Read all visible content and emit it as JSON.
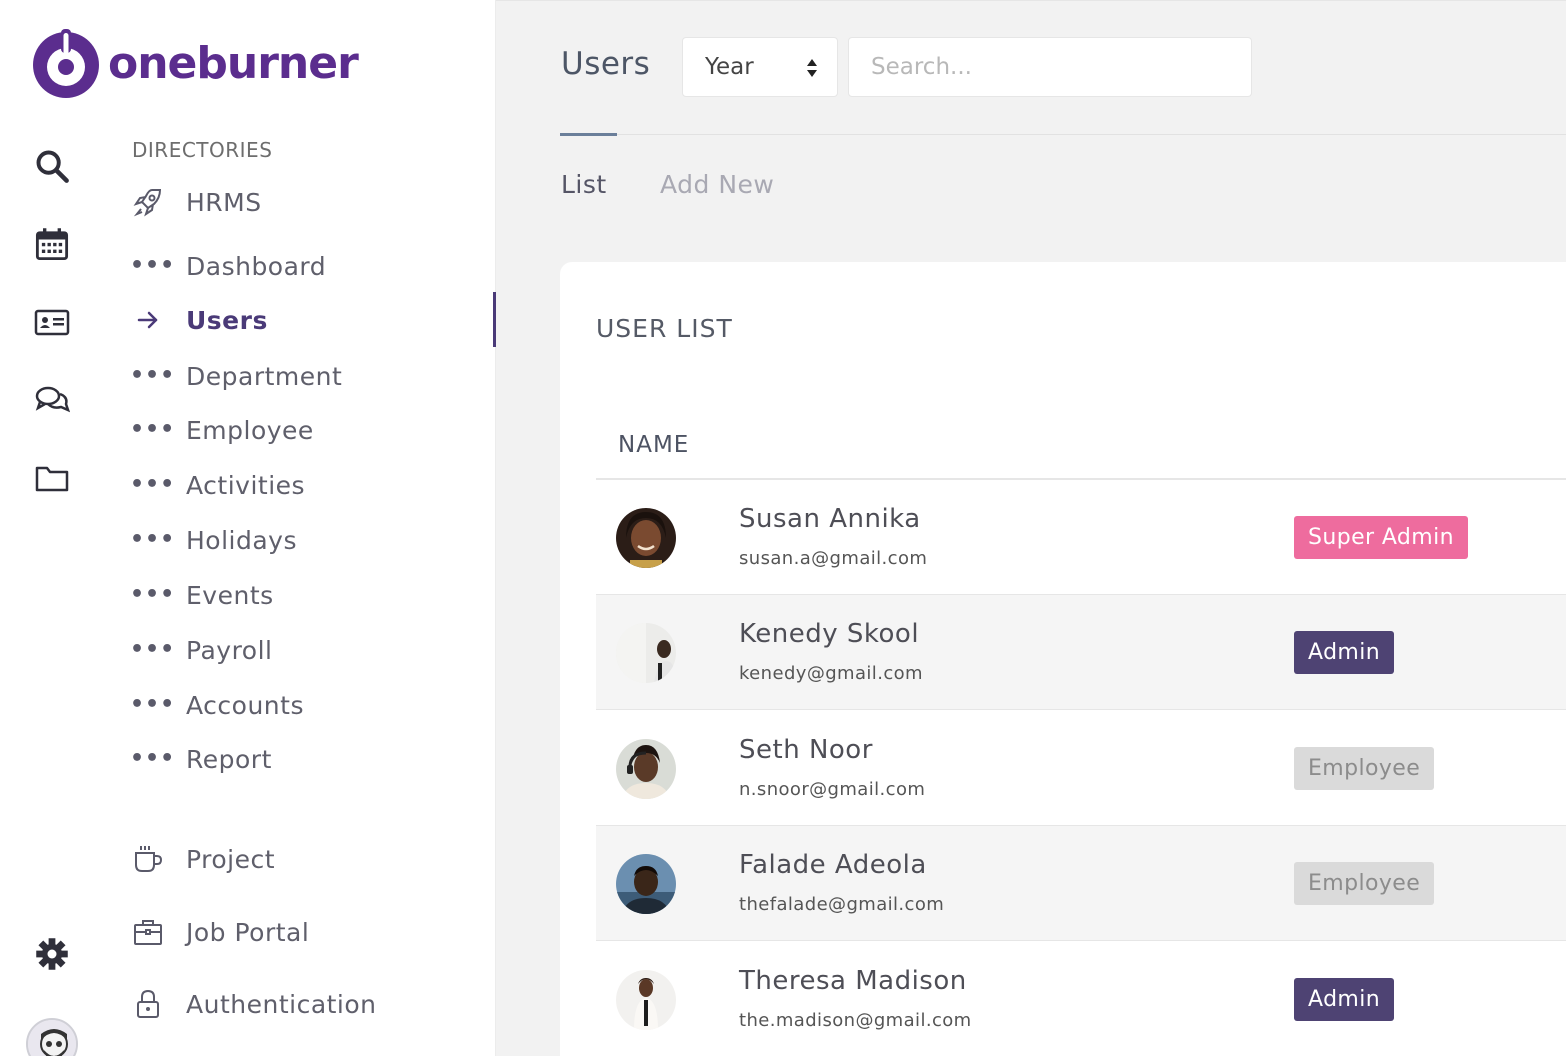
{
  "brand": {
    "name": "oneburner",
    "color": "#5b2d8e"
  },
  "rail": {
    "icons": [
      "search-icon",
      "calendar-icon",
      "id-card-icon",
      "chat-icon",
      "folder-icon",
      "settings-icon"
    ]
  },
  "sidebar": {
    "section_label": "DIRECTORIES",
    "hrms_label": "HRMS",
    "items": [
      {
        "label": "Dashboard"
      },
      {
        "label": "Users",
        "active": true
      },
      {
        "label": "Department"
      },
      {
        "label": "Employee"
      },
      {
        "label": "Activities"
      },
      {
        "label": "Holidays"
      },
      {
        "label": "Events"
      },
      {
        "label": "Payroll"
      },
      {
        "label": "Accounts"
      },
      {
        "label": "Report"
      }
    ],
    "project_label": "Project",
    "job_portal_label": "Job Portal",
    "authentication_label": "Authentication",
    "dots": "•••"
  },
  "header": {
    "title": "Users",
    "period_select": {
      "value": "Year"
    },
    "search": {
      "placeholder": "Search..."
    }
  },
  "tabs": [
    {
      "label": "List",
      "active": true
    },
    {
      "label": "Add New"
    }
  ],
  "user_list": {
    "title": "USER LIST",
    "column_name": "NAME",
    "rows": [
      {
        "name": "Susan Annika",
        "email": "susan.a@gmail.com",
        "role": "Super Admin"
      },
      {
        "name": "Kenedy Skool",
        "email": "kenedy@gmail.com",
        "role": "Admin"
      },
      {
        "name": "Seth Noor",
        "email": "n.snoor@gmail.com",
        "role": "Employee"
      },
      {
        "name": "Falade Adeola",
        "email": "thefalade@gmail.com",
        "role": "Employee"
      },
      {
        "name": "Theresa Madison",
        "email": "the.madison@gmail.com",
        "role": "Admin"
      }
    ]
  },
  "colors": {
    "super_admin": "#ee6c9e",
    "admin": "#4e4373",
    "employee": "#dadada",
    "active_accent": "#4a3a78"
  }
}
